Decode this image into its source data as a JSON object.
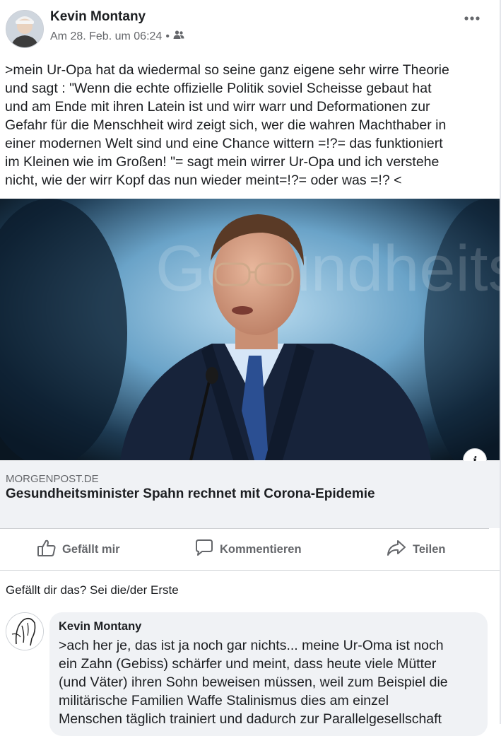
{
  "post": {
    "author": "Kevin Montany",
    "timestamp": "Am 28. Feb. um 06:24",
    "separator": "•",
    "audience_icon": "friends-icon",
    "more_icon": "more-options-icon",
    "text_lines": [
      ">mein Ur-Opa hat da wiedermal so seine ganz eigene sehr wirre Theorie",
      "und sagt : \"Wenn die echte offizielle Politik soviel Scheisse gebaut hat",
      "und am Ende mit ihren Latein ist und wirr warr und Deformationen zur",
      "Gefahr für die Menschheit wird zeigt sich, wer die wahren Machthaber in",
      "einer modernen Welt sind  und eine Chance wittern  =!?= das funktioniert",
      "im Kleinen wie im Großen! \"= sagt mein wirrer  Ur-Opa und ich verstehe",
      "nicht, wie der wirr Kopf das nun wieder meint=!?= oder was =!? <"
    ]
  },
  "link_preview": {
    "domain": "MORGENPOST.DE",
    "title": "Gesundheitsminister Spahn rechnet mit Corona-Epidemie",
    "info_label": "i",
    "backdrop_text": "Gesundheitsministerium"
  },
  "actions": {
    "like": "Gefällt mir",
    "comment": "Kommentieren",
    "share": "Teilen"
  },
  "likes_prompt": "Gefällt dir das? Sei die/der Erste",
  "comment": {
    "author": "Kevin Montany",
    "text_lines": [
      ">ach her je, das ist ja noch gar nichts... meine Ur-Oma ist noch",
      "ein Zahn (Gebiss) schärfer und meint, dass heute viele Mütter",
      "(und Väter) ihren Sohn beweisen müssen, weil zum Beispiel die",
      "militärische Familien Waffe Stalinismus dies am einzel",
      "Menschen  täglich trainiert und dadurch zur Parallelgesellschaft"
    ]
  },
  "colors": {
    "text": "#1c1e21",
    "secondary_text": "#65676b",
    "surface": "#f0f2f5",
    "divider": "#ced0d4"
  }
}
